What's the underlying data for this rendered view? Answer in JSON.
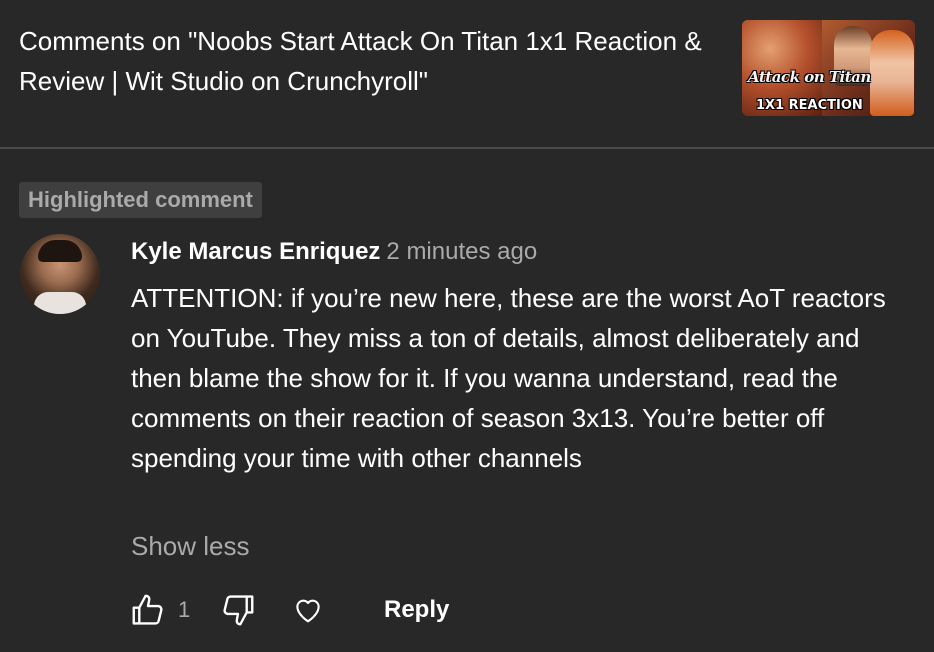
{
  "header": {
    "title": "Comments on \"Noobs Start Attack On Titan 1x1 Reaction & Review | Wit Studio on Crunchyroll\"",
    "thumbnail": {
      "logo_text": "Attack on Titan",
      "label": "1X1 REACTION"
    }
  },
  "highlighted_badge": "Highlighted comment",
  "comment": {
    "author": "Kyle Marcus Enriquez",
    "timestamp": "2 minutes ago",
    "body": "ATTENTION: if you’re new here, these are the worst AoT reactors on YouTube. They miss a ton of details, almost deliberately and then blame the show for it. If you wanna understand, read the comments on their reaction of season 3x13. You’re better off spending your time with other channels",
    "show_less": "Show less",
    "like_count": "1",
    "reply_label": "Reply"
  },
  "icons": {
    "like": "thumbs-up-icon",
    "dislike": "thumbs-down-icon",
    "heart": "heart-icon"
  },
  "colors": {
    "background": "#282828",
    "text_primary": "#ffffff",
    "text_secondary": "#aaaaaa",
    "badge_bg": "#3f3f3f",
    "divider": "#4a4a4a"
  }
}
